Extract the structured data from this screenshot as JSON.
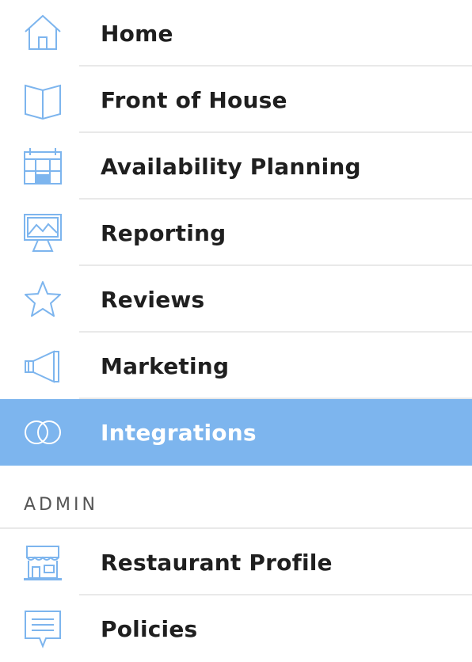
{
  "nav": {
    "items": [
      {
        "label": "Home",
        "icon": "home-icon"
      },
      {
        "label": "Front of House",
        "icon": "map-icon"
      },
      {
        "label": "Availability Planning",
        "icon": "calendar-icon"
      },
      {
        "label": "Reporting",
        "icon": "presentation-chart-icon"
      },
      {
        "label": "Reviews",
        "icon": "star-icon"
      },
      {
        "label": "Marketing",
        "icon": "megaphone-icon"
      },
      {
        "label": "Integrations",
        "icon": "interlocking-rings-icon",
        "active": true
      }
    ]
  },
  "admin": {
    "title": "ADMIN",
    "items": [
      {
        "label": "Restaurant Profile",
        "icon": "storefront-icon"
      },
      {
        "label": "Policies",
        "icon": "document-chat-icon"
      }
    ]
  },
  "colors": {
    "accent": "#7db5ee",
    "icon_stroke": "#7db5ee",
    "divider": "#e9e9e9"
  }
}
